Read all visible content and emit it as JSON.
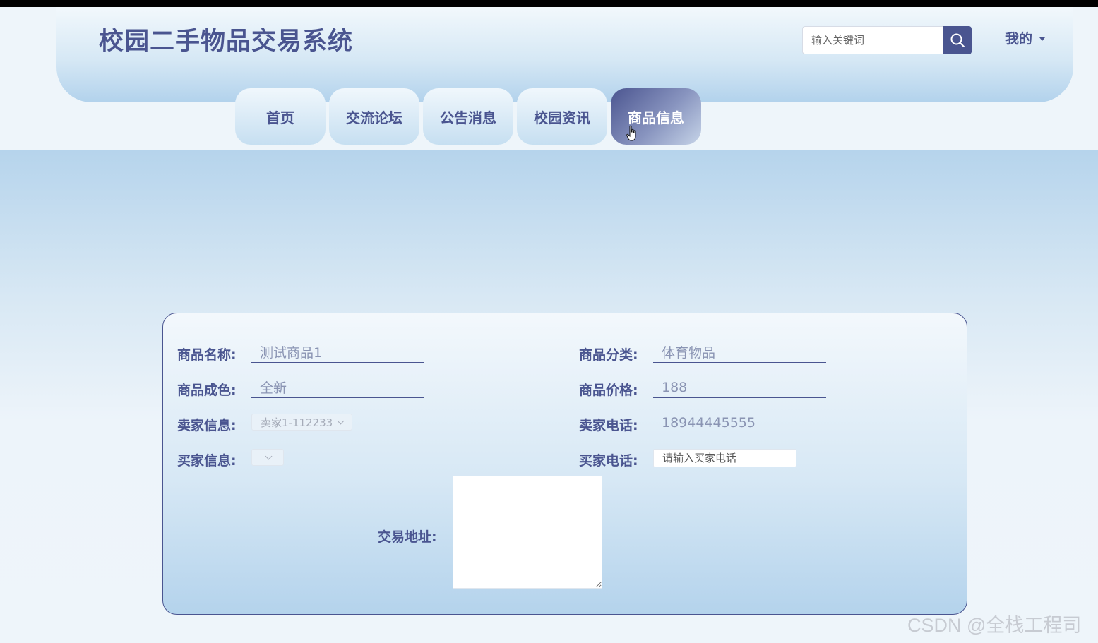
{
  "header": {
    "title": "校园二手物品交易系统",
    "search_placeholder": "输入关键词",
    "user_menu_label": "我的"
  },
  "nav": {
    "tabs": [
      {
        "label": "首页",
        "active": false
      },
      {
        "label": "交流论坛",
        "active": false
      },
      {
        "label": "公告消息",
        "active": false
      },
      {
        "label": "校园资讯",
        "active": false
      },
      {
        "label": "商品信息",
        "active": true
      }
    ]
  },
  "form": {
    "product_name": {
      "label": "商品名称:",
      "value": "测试商品1"
    },
    "category": {
      "label": "商品分类:",
      "value": "体育物品"
    },
    "condition": {
      "label": "商品成色:",
      "value": "全新"
    },
    "price": {
      "label": "商品价格:",
      "value": "188"
    },
    "seller_info": {
      "label": "卖家信息:",
      "value": "卖家1-112233"
    },
    "seller_phone": {
      "label": "卖家电话:",
      "value": "18944445555"
    },
    "buyer_info": {
      "label": "买家信息:",
      "value": ""
    },
    "buyer_phone": {
      "label": "买家电话:",
      "placeholder": "请输入买家电话"
    },
    "address": {
      "label": "交易地址:",
      "value": ""
    }
  },
  "watermark": "CSDN @全栈工程司",
  "colors": {
    "brand": "#4a5590",
    "header_light": "#f2f8fc",
    "header_dark": "#b2d2ec",
    "active_tab": "#4b5590"
  }
}
